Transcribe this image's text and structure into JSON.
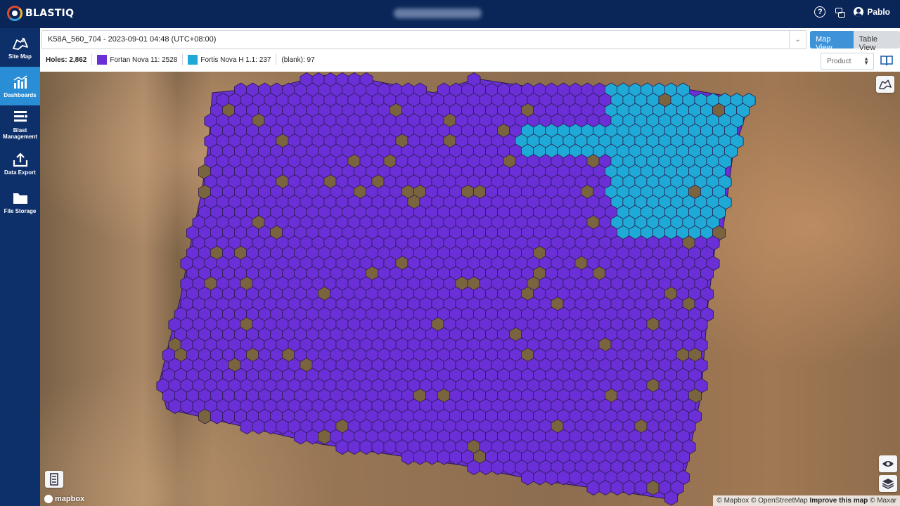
{
  "app": {
    "brand": "BLASTIQ",
    "user": "Pablo"
  },
  "sidebar": {
    "items": [
      {
        "label": "Site Map",
        "icon": "map-icon",
        "active": false
      },
      {
        "label": "Dashboards",
        "icon": "chart-icon",
        "active": true
      },
      {
        "label": "Blast Management",
        "icon": "list-icon",
        "active": false
      },
      {
        "label": "Data Export",
        "icon": "upload-icon",
        "active": false
      },
      {
        "label": "File Storage",
        "icon": "folder-icon",
        "active": false
      }
    ]
  },
  "header": {
    "blast_selected": "K58A_560_704 - 2023-09-01 04:48 (UTC+08:00)",
    "map_view_label": "Map View",
    "table_view_label": "Table View",
    "holes_label": "Holes: 2,862",
    "legend": [
      {
        "label": "Fortan Nova 11: 2528",
        "color": "#6a2fd6"
      },
      {
        "label": "Fortis Nova H 1.1: 237",
        "color": "#1ea9d6"
      },
      {
        "label": "(blank): 97",
        "color": ""
      }
    ],
    "product_select": "Product"
  },
  "map": {
    "mapbox_label": "mapbox",
    "attribution_prefix": "© Mapbox © OpenStreetMap",
    "attribution_link": "Improve this map",
    "attribution_suffix": "© Maxar",
    "colors": {
      "product_a": "#6a2fd6",
      "product_b": "#1ea9d6",
      "blank": "#7a6440",
      "cell_stroke": "#2a1a4a"
    }
  }
}
